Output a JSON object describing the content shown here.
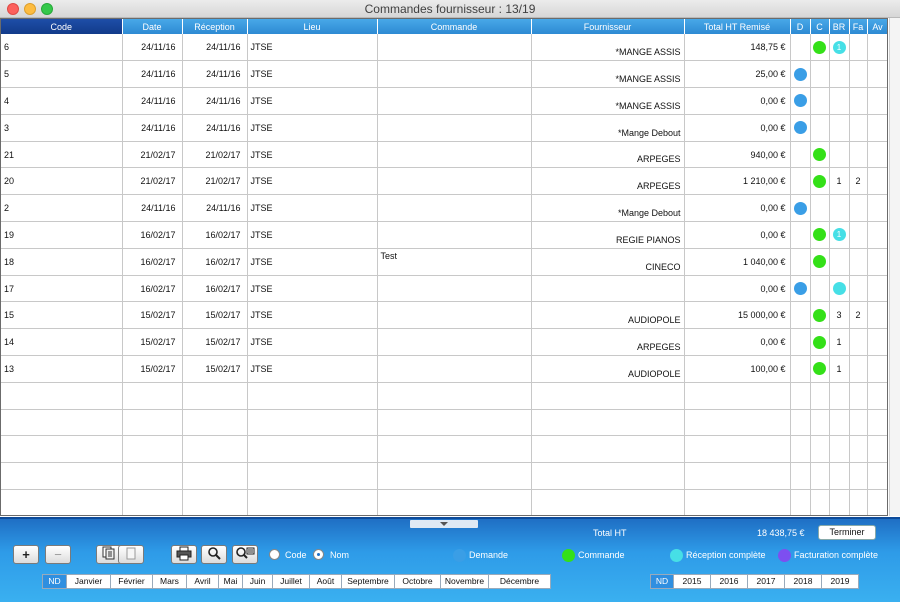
{
  "window": {
    "title": "Commandes fournisseur : 13/19"
  },
  "columns": [
    "Code",
    "Date",
    "Réception",
    "Lieu",
    "Commande",
    "Fournisseur",
    "Total HT Remisé",
    "D",
    "C",
    "BR",
    "Fa",
    "Av"
  ],
  "rows": [
    {
      "code": "6",
      "date": "24/11/16",
      "rec": "24/11/16",
      "lieu": "JTSE",
      "cmd": "",
      "four": "*MANGE ASSIS",
      "total": "148,75 €",
      "d": "",
      "c": "green",
      "br": "1",
      "br_style": "cyan",
      "fa": "",
      "av": ""
    },
    {
      "code": "5",
      "date": "24/11/16",
      "rec": "24/11/16",
      "lieu": "JTSE",
      "cmd": "",
      "four": "*MANGE ASSIS",
      "total": "25,00 €",
      "d": "blue",
      "c": "",
      "br": "",
      "br_style": "",
      "fa": "",
      "av": ""
    },
    {
      "code": "4",
      "date": "24/11/16",
      "rec": "24/11/16",
      "lieu": "JTSE",
      "cmd": "",
      "four": "*MANGE ASSIS",
      "total": "0,00 €",
      "d": "blue",
      "c": "",
      "br": "",
      "br_style": "",
      "fa": "",
      "av": ""
    },
    {
      "code": "3",
      "date": "24/11/16",
      "rec": "24/11/16",
      "lieu": "JTSE",
      "cmd": "",
      "four": "*Mange Debout",
      "total": "0,00 €",
      "d": "blue",
      "c": "",
      "br": "",
      "br_style": "",
      "fa": "",
      "av": ""
    },
    {
      "code": "21",
      "date": "21/02/17",
      "rec": "21/02/17",
      "lieu": "JTSE",
      "cmd": "",
      "four": "ARPEGES",
      "total": "940,00 €",
      "d": "",
      "c": "green",
      "br": "",
      "br_style": "",
      "fa": "",
      "av": ""
    },
    {
      "code": "20",
      "date": "21/02/17",
      "rec": "21/02/17",
      "lieu": "JTSE",
      "cmd": "",
      "four": "ARPEGES",
      "total": "1 210,00 €",
      "d": "",
      "c": "green",
      "br": "1",
      "br_style": "text",
      "fa": "2",
      "av": ""
    },
    {
      "code": "2",
      "date": "24/11/16",
      "rec": "24/11/16",
      "lieu": "JTSE",
      "cmd": "",
      "four": "*Mange Debout",
      "total": "0,00 €",
      "d": "blue",
      "c": "",
      "br": "",
      "br_style": "",
      "fa": "",
      "av": ""
    },
    {
      "code": "19",
      "date": "16/02/17",
      "rec": "16/02/17",
      "lieu": "JTSE",
      "cmd": "",
      "four": "REGIE PIANOS",
      "total": "0,00 €",
      "d": "",
      "c": "green",
      "br": "1",
      "br_style": "cyan",
      "fa": "",
      "av": ""
    },
    {
      "code": "18",
      "date": "16/02/17",
      "rec": "16/02/17",
      "lieu": "JTSE",
      "cmd": "Test",
      "four": "CINECO",
      "total": "1 040,00 €",
      "d": "",
      "c": "green",
      "br": "",
      "br_style": "",
      "fa": "",
      "av": ""
    },
    {
      "code": "17",
      "date": "16/02/17",
      "rec": "16/02/17",
      "lieu": "JTSE",
      "cmd": "",
      "four": "",
      "total": "0,00 €",
      "d": "blue",
      "c": "",
      "br": "",
      "br_style": "cyan-empty",
      "fa": "",
      "av": ""
    },
    {
      "code": "15",
      "date": "15/02/17",
      "rec": "15/02/17",
      "lieu": "JTSE",
      "cmd": "",
      "four": "AUDIOPOLE",
      "total": "15 000,00 €",
      "d": "",
      "c": "green",
      "br": "3",
      "br_style": "text",
      "fa": "2",
      "av": ""
    },
    {
      "code": "14",
      "date": "15/02/17",
      "rec": "15/02/17",
      "lieu": "JTSE",
      "cmd": "",
      "four": "ARPEGES",
      "total": "0,00 €",
      "d": "",
      "c": "green",
      "br": "1",
      "br_style": "text",
      "fa": "",
      "av": ""
    },
    {
      "code": "13",
      "date": "15/02/17",
      "rec": "15/02/17",
      "lieu": "JTSE",
      "cmd": "",
      "four": "AUDIOPOLE",
      "total": "100,00 €",
      "d": "",
      "c": "green",
      "br": "1",
      "br_style": "text",
      "fa": "",
      "av": ""
    }
  ],
  "footer": {
    "total_label": "Total HT",
    "total_value": "18 438,75 €",
    "terminer": "Terminer",
    "sort_code": "Code",
    "sort_nom": "Nom",
    "legend": {
      "demande": "Demande",
      "commande": "Commande",
      "reception": "Réception complète",
      "facturation": "Facturation complète"
    },
    "months": [
      "ND",
      "Janvier",
      "Février",
      "Mars",
      "Avril",
      "Mai",
      "Juin",
      "Juillet",
      "Août",
      "Septembre",
      "Octobre",
      "Novembre",
      "Décembre"
    ],
    "years": [
      "ND",
      "2015",
      "2016",
      "2017",
      "2018",
      "2019"
    ]
  },
  "colors": {
    "demande": "#3a9ee6",
    "commande": "#34e018",
    "reception": "#46dfe6",
    "facturation": "#7d4ff0"
  }
}
